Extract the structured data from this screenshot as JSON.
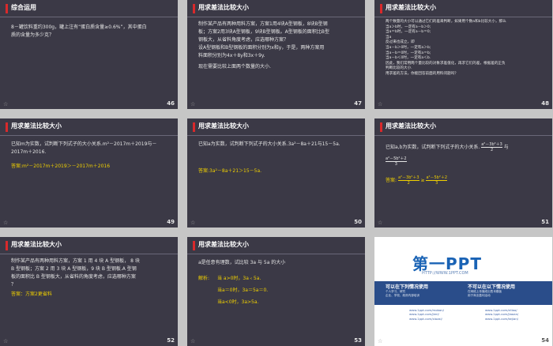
{
  "slides": [
    {
      "num": "46",
      "title": "综合运用",
      "lines": [
        "8－罐饮料重约300g，罐上注有“蛋白质含量≥0.6%”，其中蛋白",
        "质的含量为多少克？"
      ]
    },
    {
      "num": "47",
      "title": "用求差法比较大小",
      "lines": [
        "制作某产品有两种用料方案，方案1用4块A型钢板，8块B型钢",
        "板；方案2用3块A型钢板，9块B型钢板。A型钢板的面积比B型",
        "钢板大，从省料角度考虑，应选哪种方案？",
        "设A型钢板和B型钢板的面积分别为x和y，于是，两种方案用",
        "料面积分别为4x＋8y和3x＋9y.",
        "",
        "现在需要比较上面两个数量的大小."
      ]
    },
    {
      "num": "48",
      "title": "用求差法比较大小",
      "lines": [
        "两个数量的大小可以通过它们的差来判断，如果用个数a和b比较大小，那么",
        "当a＞b时，一定有a－b＞0;",
        "当a＝b时，一定有a－b＝0;",
        "当a",
        "反过来也成立，即",
        "当a－b＞0时，一定有a＞b;",
        "当a－b＝0时，一定有a＝b;",
        "当a－b＜0时，一定有a＜b.",
        "因此，我们常用两个量比较的对象求差值化，再求它们的差，根据差的正负",
        "判断比较的大小.",
        "",
        "用求差的方法，你能回答前面的用料问题吗？"
      ]
    },
    {
      "num": "49",
      "title": "用求差法比较大小",
      "lines": [
        "已知m为实数，试判断下列式子的大小关系.m²－2017m＋2019与－",
        "2017m＋2016."
      ],
      "answer": "答案:m²－2017m＋2019＞－2017m＋2016"
    },
    {
      "num": "50",
      "title": "用求差法比较大小",
      "lines": [
        "已知a为实数，试判断下列式子的大小关系.3a²－8a＋21与15－5a."
      ],
      "answer": "答案:3a²－8a＋21＞15－5a."
    },
    {
      "num": "51",
      "title": "用求差法比较大小",
      "lines": [
        "已知a,b为实数，试判断下列式子的大小关系.",
        "与"
      ],
      "answer": "答案:",
      "f1": "a²－3b²＋3",
      "f2": "2",
      "f3": "a²－5b²＋2",
      "f4": "3"
    },
    {
      "num": "52",
      "title": "用求差法比较大小",
      "lines": [
        "制作某产品有两种用料方案，方案 1 用 4 块 A 型钢板， 8 块",
        "B 型钢板；方案 2 用 3 块 A 型钢板，9 块 B 型钢板.A 型钢",
        "板的面积比 B 型钢板大，从省料的角度考虑，应选哪种方案",
        "？"
      ],
      "answer": "答案：方案2更省料"
    },
    {
      "num": "53",
      "title": "用求差法比较大小",
      "lines": [
        "a是任意有理数，试比较 3a 与 5a 的大小"
      ],
      "sol_label": "解析:",
      "sol": [
        "当 a>0时，3a﹤5a.",
        "当a＝0时，3a＝5a＝0.",
        "当a<0时，3a>5a."
      ]
    },
    {
      "num": "54",
      "logo": "第一PPT",
      "url": "HTTP://WWW.1PPT.COM",
      "cap1": "可以在下列情况使用",
      "cap2": "不可以在以下情况使用",
      "l1": [
        "个人学习、研究",
        "企业、学校、政府内部培训"
      ],
      "l2": [
        "在网络上传播或出售本模板",
        "用于商业盈利活动"
      ],
      "links": [
        "www.1ppt.com/moban/",
        "www.1ppt.com/jieri/",
        "www.1ppt.com/xiazai/",
        "www.1ppt.com/ziliao/",
        "www.1ppt.com/jiaoan/",
        "www.1ppt.com/kejian/"
      ]
    }
  ],
  "colors": {
    "slide_bg": "#3b3946",
    "accent": "#d9292b",
    "answer": "#f0d000"
  }
}
